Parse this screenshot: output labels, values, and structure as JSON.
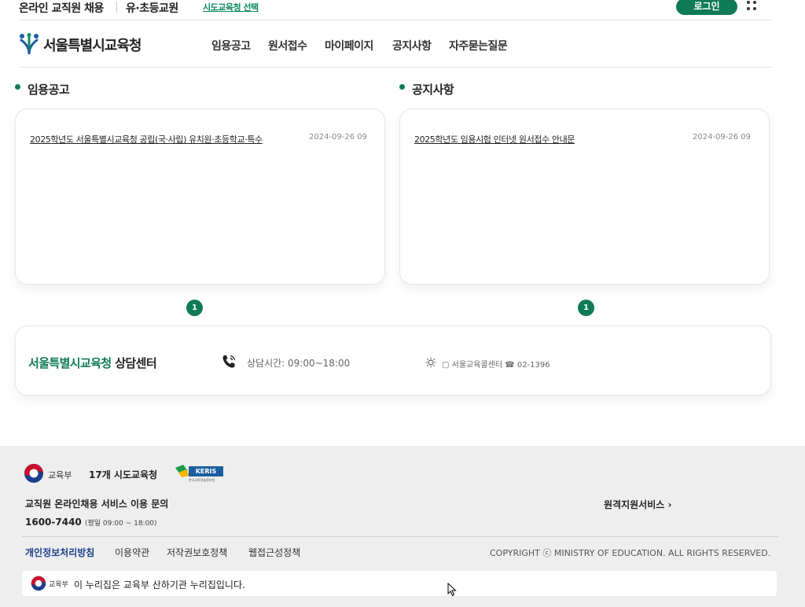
{
  "topbar": {
    "recruit_label": "온라인 교직원 채용",
    "category_label": "유·초등교원",
    "office_select_label": "시도교육청 선택",
    "login_label": "로그인",
    "menu_icon": "apps-grid-icon"
  },
  "header": {
    "logo_text": "서울특별시교육청",
    "nav": [
      {
        "label": "임용공고"
      },
      {
        "label": "원서접수"
      },
      {
        "label": "마이페이지"
      },
      {
        "label": "공지사항"
      },
      {
        "label": "자주묻는질문"
      }
    ]
  },
  "recruit_section": {
    "title": "임용공고",
    "posts": [
      {
        "title": "2025학년도 서울특별시교육청 공립(국·사립) 유치원·초등학교·특수",
        "date": "2024-09-26 09"
      }
    ],
    "page": "1"
  },
  "notice_section": {
    "title": "공지사항",
    "posts": [
      {
        "title": "2025학년도 임용시험 인터넷 원서접수 안내문",
        "date": "2024-09-26 09"
      }
    ],
    "page": "1"
  },
  "counsel": {
    "office_name": "서울특별시교육청",
    "suffix": " 상담센터",
    "hours": "상담시간: 09:00~18:00",
    "contact": "서울교육콜센터 ☎ 02-1396"
  },
  "footer": {
    "moe_label": "교육부",
    "regions_label": "17개 시도교육청",
    "keris_label": "KERIS",
    "keris_sub": "한국교육학술정보원",
    "inquiry_label": "교직원 온라인채용 서비스 이용 문의",
    "phone": "1600-7440",
    "phone_hours": "(평일 09:00 ~ 18:00)",
    "remote_label": "원격지원서비스 ›",
    "links": [
      {
        "label": "개인정보처리방침"
      },
      {
        "label": "이용약관"
      },
      {
        "label": "저작권보호정책"
      },
      {
        "label": "웹접근성정책"
      }
    ],
    "copyright": "COPYRIGHT ⓒ MINISTRY OF EDUCATION. ALL RIGHTS RESERVED.",
    "notice_moe_label": "교육부",
    "notice_text": "이 누리집은 교육부 산하기관 누리집입니다."
  },
  "colors": {
    "brand_green": "#0f7a56",
    "footer_bg": "#eeeeee"
  }
}
